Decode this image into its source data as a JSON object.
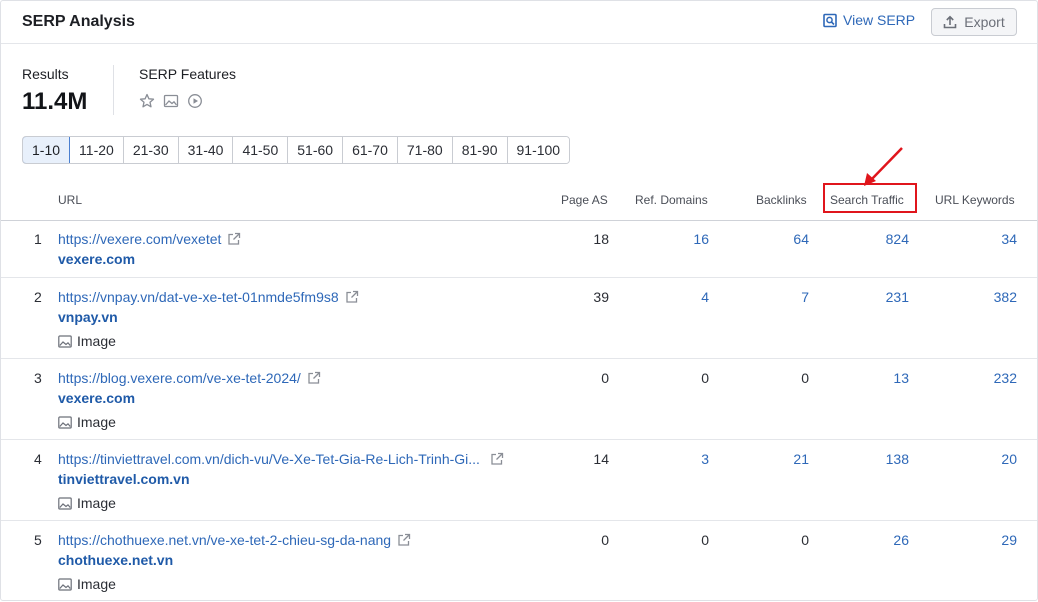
{
  "header": {
    "title": "SERP Analysis",
    "view_serp_label": "View SERP",
    "export_label": "Export"
  },
  "summary": {
    "results_label": "Results",
    "results_value": "11.4M",
    "features_label": "SERP Features",
    "feature_icons": [
      "star-icon",
      "image-icon",
      "video-icon"
    ]
  },
  "pagination": [
    "1-10",
    "11-20",
    "21-30",
    "31-40",
    "41-50",
    "51-60",
    "61-70",
    "71-80",
    "81-90",
    "91-100"
  ],
  "columns": {
    "url": "URL",
    "page_as": "Page AS",
    "ref_domains": "Ref. Domains",
    "backlinks": "Backlinks",
    "search_traffic": "Search Traffic",
    "url_keywords": "URL Keywords"
  },
  "rows": [
    {
      "num": "1",
      "url": "https://vexere.com/vexetet",
      "domain": "vexere.com",
      "image_label": "",
      "page_as": "18",
      "ref_domains": "16",
      "backlinks": "64",
      "search_traffic": "824",
      "url_keywords": "34"
    },
    {
      "num": "2",
      "url": "https://vnpay.vn/dat-ve-xe-tet-01nmde5fm9s8",
      "domain": "vnpay.vn",
      "image_label": "Image",
      "page_as": "39",
      "ref_domains": "4",
      "backlinks": "7",
      "search_traffic": "231",
      "url_keywords": "382"
    },
    {
      "num": "3",
      "url": "https://blog.vexere.com/ve-xe-tet-2024/",
      "domain": "vexere.com",
      "image_label": "Image",
      "page_as": "0",
      "ref_domains": "0",
      "backlinks": "0",
      "search_traffic": "13",
      "url_keywords": "232"
    },
    {
      "num": "4",
      "url": "https://tinviettravel.com.vn/dich-vu/Ve-Xe-Tet-Gia-Re-Lich-Trinh-Gi...",
      "domain": "tinviettravel.com.vn",
      "image_label": "Image",
      "page_as": "14",
      "ref_domains": "3",
      "backlinks": "21",
      "search_traffic": "138",
      "url_keywords": "20"
    },
    {
      "num": "5",
      "url": "https://chothuexe.net.vn/ve-xe-tet-2-chieu-sg-da-nang",
      "domain": "chothuexe.net.vn",
      "image_label": "Image",
      "page_as": "0",
      "ref_domains": "0",
      "backlinks": "0",
      "search_traffic": "26",
      "url_keywords": "29"
    }
  ],
  "colors": {
    "link": "#2e68b8",
    "domain": "#1f5aa8",
    "highlight": "#e0151c"
  }
}
